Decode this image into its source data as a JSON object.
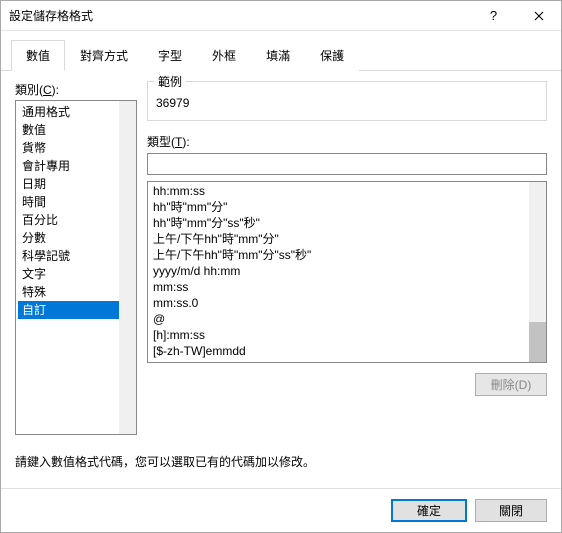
{
  "window": {
    "title": "設定儲存格格式"
  },
  "tabs": {
    "items": [
      {
        "label": "數值"
      },
      {
        "label": "對齊方式"
      },
      {
        "label": "字型"
      },
      {
        "label": "外框"
      },
      {
        "label": "填滿"
      },
      {
        "label": "保護"
      }
    ],
    "active_index": 0
  },
  "category": {
    "label_prefix": "類別(",
    "label_key": "C",
    "label_suffix": "):",
    "items": [
      "通用格式",
      "數值",
      "貨幣",
      "會計專用",
      "日期",
      "時間",
      "百分比",
      "分數",
      "科學記號",
      "文字",
      "特殊",
      "自訂"
    ],
    "selected_index": 11
  },
  "sample": {
    "label": "範例",
    "value": "36979"
  },
  "type": {
    "label_prefix": "類型(",
    "label_key": "T",
    "label_suffix": "):",
    "value": "",
    "formats": [
      "hh:mm:ss",
      "hh\"時\"mm\"分\"",
      "hh\"時\"mm\"分\"ss\"秒\"",
      "上午/下午hh\"時\"mm\"分\"",
      "上午/下午hh\"時\"mm\"分\"ss\"秒\"",
      "yyyy/m/d hh:mm",
      "mm:ss",
      "mm:ss.0",
      "@",
      "[h]:mm:ss",
      "[$-zh-TW]emmdd"
    ]
  },
  "delete": {
    "label": "刪除(D)"
  },
  "hint": "請鍵入數值格式代碼，您可以選取已有的代碼加以修改。",
  "footer": {
    "ok": "確定",
    "close": "關閉"
  }
}
